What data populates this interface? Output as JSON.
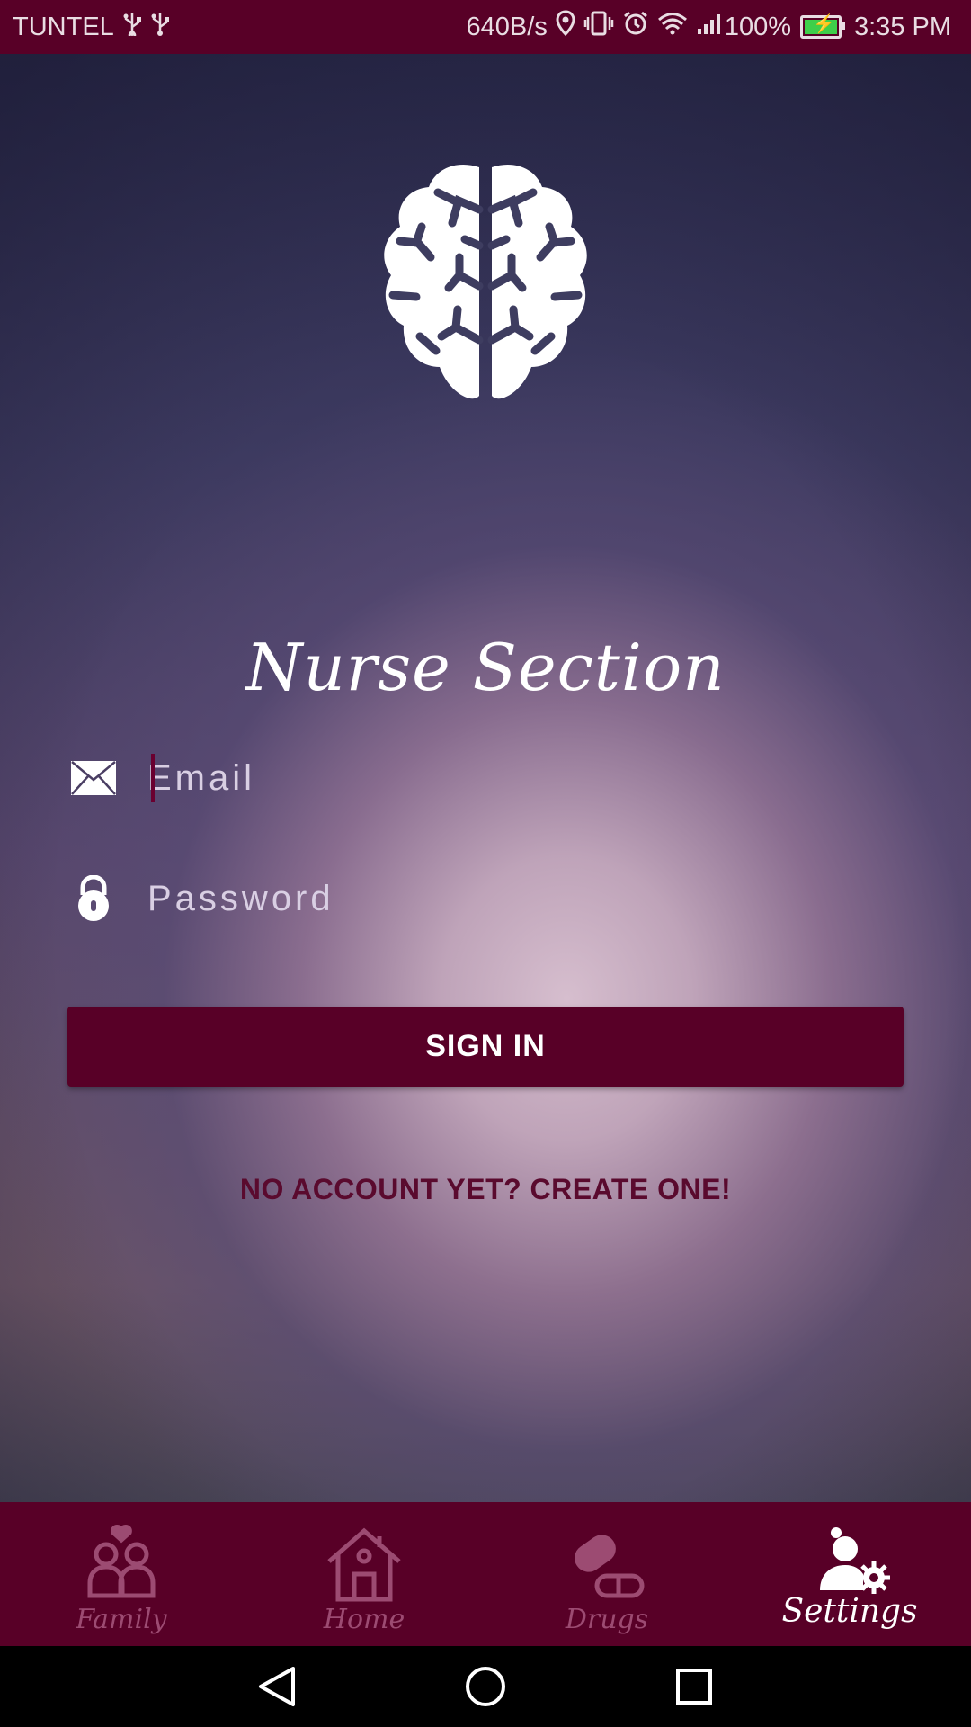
{
  "status_bar": {
    "carrier": "TUNTEL",
    "net_speed": "640B/s",
    "battery": "100%",
    "time": "3:35 PM",
    "icons": [
      "usb-icon",
      "usb-icon",
      "location-icon",
      "vibrate-icon",
      "alarm-icon",
      "wifi-icon",
      "signal-icon",
      "battery-icon"
    ]
  },
  "screen": {
    "title": "Nurse Section",
    "logo": "brain-icon"
  },
  "form": {
    "email_placeholder": "Email",
    "password_placeholder": "Password",
    "sign_in_label": "SIGN IN",
    "create_account_label": "NO ACCOUNT YET? CREATE ONE!"
  },
  "bottom_nav": {
    "items": [
      {
        "label": "Family",
        "icon": "family-icon",
        "active": false
      },
      {
        "label": "Home",
        "icon": "home-icon",
        "active": false
      },
      {
        "label": "Drugs",
        "icon": "pill-icon",
        "active": false
      },
      {
        "label": "Settings",
        "icon": "user-settings-icon",
        "active": true
      }
    ]
  },
  "colors": {
    "accent": "#580027",
    "inactive_nav": "#9c4b72",
    "link": "#5a0a2e"
  }
}
